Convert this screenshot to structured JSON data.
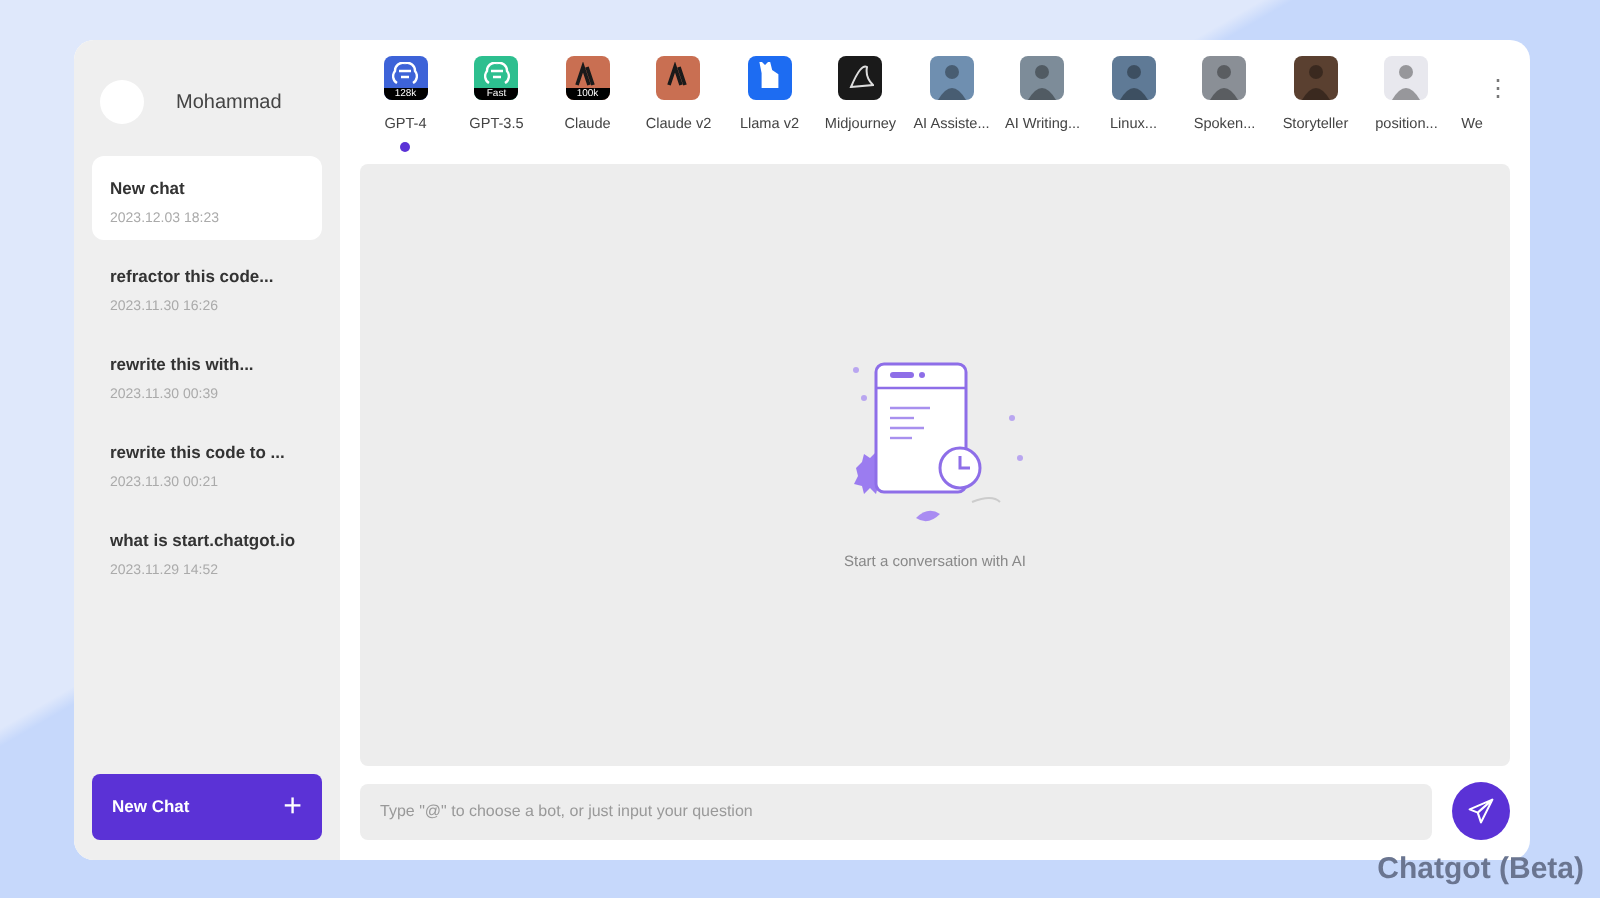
{
  "user": {
    "name": "Mohammad"
  },
  "chats": [
    {
      "title": "New chat",
      "date": "2023.12.03 18:23",
      "selected": true
    },
    {
      "title": "refractor this code...",
      "date": "2023.11.30 16:26",
      "selected": false
    },
    {
      "title": "rewrite this with...",
      "date": "2023.11.30 00:39",
      "selected": false
    },
    {
      "title": "rewrite this code to ...",
      "date": "2023.11.30 00:21",
      "selected": false
    },
    {
      "title": "what is start.chatgot.io",
      "date": "2023.11.29 14:52",
      "selected": false
    }
  ],
  "new_chat_button": {
    "label": "New Chat",
    "icon": "+"
  },
  "bots": [
    {
      "name": "GPT-4",
      "kind": "gpt",
      "badge": "128k",
      "color": "#3d63d8",
      "selected": true
    },
    {
      "name": "GPT-3.5",
      "kind": "gpt",
      "badge": "Fast",
      "color": "#2dbf8f",
      "selected": false
    },
    {
      "name": "Claude",
      "kind": "claude",
      "badge": "100k",
      "color": "#c96f52",
      "selected": false
    },
    {
      "name": "Claude v2",
      "kind": "claude",
      "color": "#c96f52",
      "selected": false
    },
    {
      "name": "Llama v2",
      "kind": "llama",
      "color": "#1d6cf2",
      "selected": false
    },
    {
      "name": "Midjourney",
      "kind": "midjourney",
      "color": "#1a1a1a",
      "selected": false
    },
    {
      "name": "AI Assiste...",
      "kind": "photo",
      "color": "#6f8fb0",
      "selected": false
    },
    {
      "name": "AI Writing...",
      "kind": "photo",
      "color": "#7d8c99",
      "selected": false
    },
    {
      "name": "Linux...",
      "kind": "photo",
      "color": "#5f7a96",
      "selected": false
    },
    {
      "name": "Spoken...",
      "kind": "photo",
      "color": "#8a8f96",
      "selected": false
    },
    {
      "name": "Storyteller",
      "kind": "photo",
      "color": "#5a4030",
      "selected": false
    },
    {
      "name": "position...",
      "kind": "photo",
      "color": "#e8e8ee",
      "selected": false
    },
    {
      "name": "We",
      "kind": "cut",
      "selected": false
    }
  ],
  "more_menu": {
    "icon": "⋮"
  },
  "empty_state": {
    "text": "Start a conversation with AI"
  },
  "input": {
    "placeholder": "Type \"@\" to choose a bot, or just input your question"
  },
  "brand": {
    "text": "Chatgot (Beta)"
  }
}
